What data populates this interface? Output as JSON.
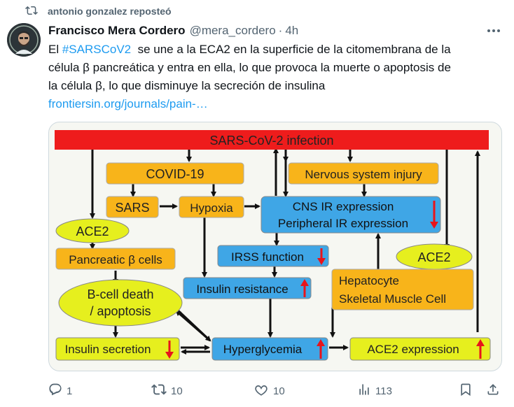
{
  "repost": {
    "text": "antonio gonzalez reposteó"
  },
  "post": {
    "author_name": "Francisco Mera Cordero",
    "handle": "@mera_cordero",
    "separator": "·",
    "time": "4h",
    "text_line1_prefix": "El ",
    "hashtag": "#SARSCoV2",
    "text_line1_rest": "  se une a la ECA2 en la superficie de la citomembrana de la",
    "text_line2": "célula β pancreática y entra en ella, lo que provoca la muerte o apoptosis de",
    "text_line3": "la célula β, lo que disminuye la secreción de insulina",
    "link": "frontiersin.org/journals/pain-…"
  },
  "diagram": {
    "top_bar": "SARS-CoV-2 infection",
    "covid": "COVID-19",
    "nervous": "Nervous system injury",
    "sars": "SARS",
    "hypoxia": "Hypoxia",
    "cns_line1": "CNS IR expression",
    "cns_line2": "Peripheral IR expression",
    "ace2_left": "ACE2",
    "pancreatic": "Pancreatic β cells",
    "irss": "IRSS function",
    "ace2_right": "ACE2",
    "insulin_resistance": "Insulin resistance",
    "bcell_line1": "B-cell death",
    "bcell_line2": "/ apoptosis",
    "hepatocyte_line1": "Hepatocyte",
    "hepatocyte_line2": "Skeletal Muscle Cell",
    "insulin_secretion": "Insulin secretion",
    "hyperglycemia": "Hyperglycemia",
    "ace2_expression": "ACE2 expression",
    "colors": {
      "red": "#ee1c1c",
      "orange": "#f8b41a",
      "blue": "#3fa6e6",
      "green": "#e6ef1e",
      "yellow": "#e8ee3a",
      "arrow_red": "#e8141b"
    }
  },
  "actions": {
    "replies": "1",
    "reposts": "10",
    "likes": "10",
    "views": "113"
  },
  "colors": {
    "link": "#1d9bf0",
    "muted": "#536471",
    "text": "#0f1419"
  }
}
